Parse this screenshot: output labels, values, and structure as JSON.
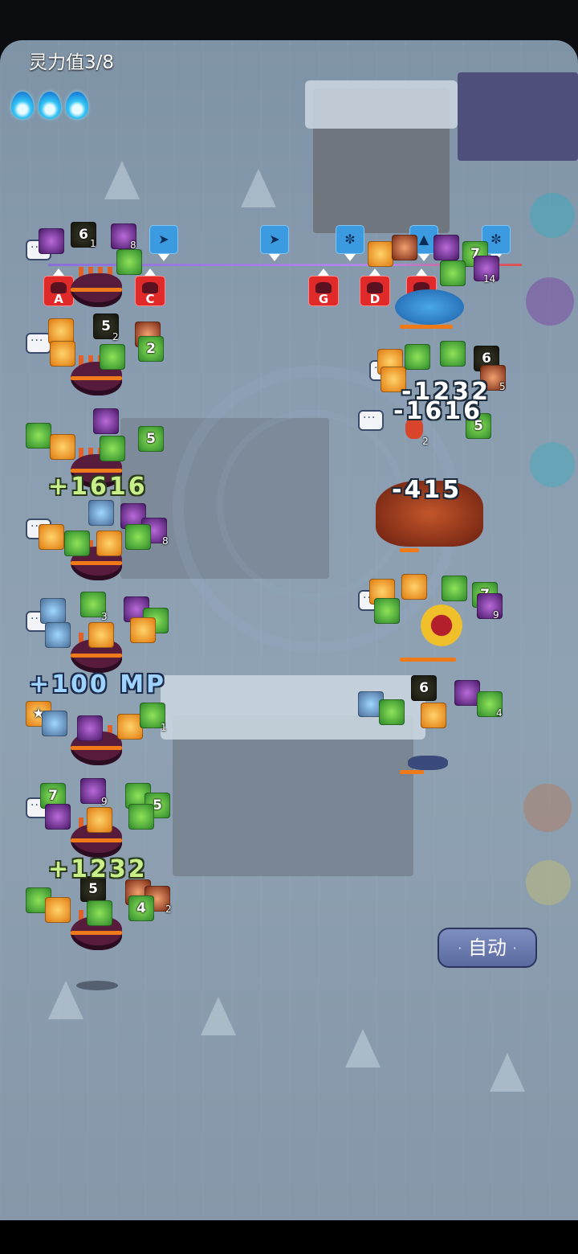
{
  "hud": {
    "mp_label": "灵力值3/8",
    "flames_count": 3,
    "flame_icon": "blue-flame-icon"
  },
  "timeline": {
    "allies": [
      "ally-turn-marker",
      "ally-turn-marker",
      "ally-turn-marker",
      "ally-turn-marker",
      "ally-turn-marker"
    ],
    "enemies": [
      {
        "label": "A"
      },
      {
        "label": "C"
      },
      {
        "label": "G"
      },
      {
        "label": "D"
      },
      {
        "label": "B"
      }
    ]
  },
  "stacks": {
    "s1": "1",
    "s8": "8",
    "s2": "2",
    "s3": "3",
    "s9": "9",
    "s5": "5",
    "s14": "14",
    "s4": "4"
  },
  "buff_numbers": {
    "six": "6",
    "five": "5",
    "two": "2",
    "seven": "7",
    "four": "4"
  },
  "floating_text": {
    "dmg1": "-1232",
    "dmg2": "-1616",
    "dmg3": "-415",
    "heal1": "+1616",
    "heal2": "+1232",
    "mp_gain": "+100 MP"
  },
  "controls": {
    "auto_label": "自动"
  }
}
